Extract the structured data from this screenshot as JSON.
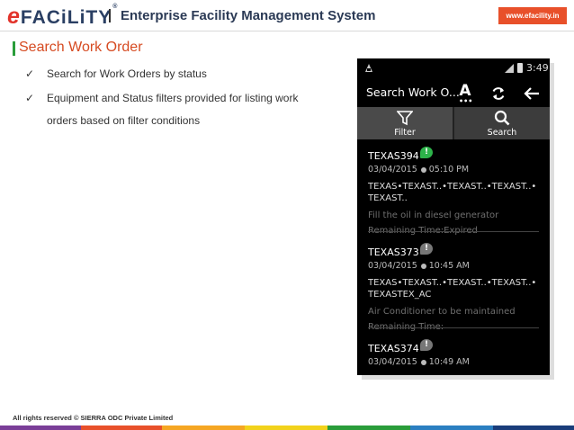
{
  "header": {
    "logo_e": "e",
    "logo_rest": "FACiLiTY",
    "logo_reg": "®",
    "title": "Enterprise Facility Management System",
    "url": "www.efacility.in"
  },
  "section": {
    "title": "Search Work Order"
  },
  "bullets": [
    "Search for Work Orders by status",
    "Equipment and Status filters provided for listing work orders based on filter conditions"
  ],
  "phone": {
    "status_time": "3:49",
    "appbar_title": "Search Work O...",
    "font_icon_letter": "A",
    "font_icon_dots": "•••",
    "toolbar": {
      "filter_label": "Filter",
      "search_label": "Search"
    },
    "items": [
      {
        "code": "TEXAS394",
        "flag_color": "#2db34a",
        "date": "03/04/2015",
        "time": "05:10 PM",
        "location": "TEXAS•TEXAST..•TEXAST..•TEXAST..•TEXAST..",
        "description": "Fill the oil in diesel generator",
        "remaining": "Remaining Time:Expired"
      },
      {
        "code": "TEXAS373",
        "flag_color": "#777777",
        "date": "03/04/2015",
        "time": "10:45 AM",
        "location": "TEXAS•TEXAST..•TEXAST..•TEXAST..•TEXASTEX_AC",
        "description": "Air Conditioner to be maintained",
        "remaining": "Remaining Time:"
      },
      {
        "code": "TEXAS374",
        "flag_color": "#777777",
        "date": "03/04/2015",
        "time": "10:49 AM",
        "location": "",
        "description": "",
        "remaining": ""
      }
    ]
  },
  "footer": {
    "text": "All rights reserved © SIERRA ODC Private Limited",
    "strip_colors": [
      "#7a3e98",
      "#e8502a",
      "#f5a623",
      "#f2d21b",
      "#2a9d3a",
      "#2b7fc1",
      "#1a3d7a"
    ]
  }
}
